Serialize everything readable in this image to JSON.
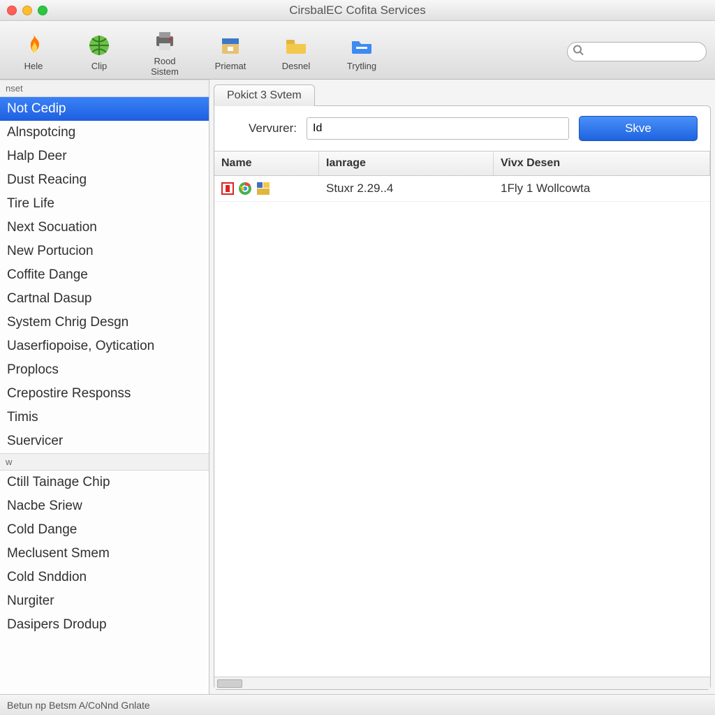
{
  "window": {
    "title": "CirsbalEC Cofita Services"
  },
  "toolbar": {
    "items": [
      {
        "name": "hele",
        "label": "Hele",
        "icon": "fire-icon"
      },
      {
        "name": "clip",
        "label": "Clip",
        "icon": "globe-icon"
      },
      {
        "name": "rood",
        "label": "Rood Sistem",
        "icon": "printer-icon"
      },
      {
        "name": "priem",
        "label": "Priemat",
        "icon": "archive-icon"
      },
      {
        "name": "desnel",
        "label": "Desnel",
        "icon": "folder-yellow-icon"
      },
      {
        "name": "tryt",
        "label": "Trytling",
        "icon": "folder-blue-icon"
      }
    ],
    "search_placeholder": ""
  },
  "sidebar": {
    "group1": {
      "header": "nset",
      "items": [
        "Not Cedip",
        "Alnspotcing",
        "Halp Deer",
        "Dust Reacing",
        "Tire Life",
        "Next Socuation",
        "New Portucion",
        "Coffite Dange",
        "Cartnal Dasup",
        "System Chrig Desgn",
        "Uaserfiopoise, Oytication",
        "Proplocs",
        "Crepostire Responss",
        "Timis",
        "Suervicer"
      ],
      "selected_index": 0
    },
    "group2": {
      "header": "w",
      "items": [
        "Ctill Tainage Chip",
        "Nacbe Sriew",
        "Cold Dange",
        "Meclusent Smem",
        "Cold Snddion",
        "Nurgiter",
        "Dasipers Drodup"
      ]
    }
  },
  "main": {
    "tab_label": "Pokict 3 Svtem",
    "form": {
      "label": "Vervurer:",
      "value": "Id",
      "save_label": "Skve"
    },
    "table": {
      "headers": {
        "name": "Name",
        "ianrage": "Ianrage",
        "vd": "Vivx Desen"
      },
      "rows": [
        {
          "name": "",
          "ianrage": "Stuxr 2.29..4",
          "vd": "1Fly 1 Wollcowta"
        }
      ]
    }
  },
  "status": "Betun np Betsm A/CoNnd Gnlate"
}
